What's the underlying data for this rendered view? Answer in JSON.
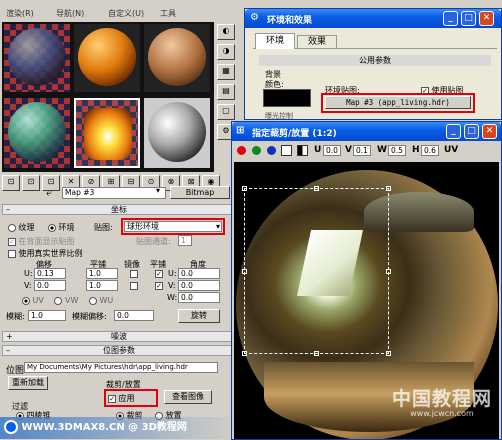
{
  "menubar": {
    "items": [
      "渲染(R)",
      "导航(N)",
      "自定义(U)",
      "工具"
    ]
  },
  "material_editor": {
    "tool_glyphs": [
      "⊡",
      "⊡",
      "⊡",
      "✕",
      "⊘",
      "⊞",
      "⊟",
      "⊙",
      "⊗",
      "⊠",
      "◉"
    ],
    "map_name": "Map #3",
    "map_type": "Bitmap",
    "coords": {
      "title": "坐标",
      "texture": "纹理",
      "environ": "环境",
      "mapping_label": "贴图:",
      "mapping_value": "球形环境",
      "show_back": "在背面显示贴图",
      "map_channel": "贴图通道:",
      "map_channel_value": "1",
      "real_world": "使用真实世界比例",
      "offset": "偏移",
      "tiling": "平铺",
      "mirror": "镜像",
      "tile": "平铺",
      "angle": "角度",
      "u_label": "U:",
      "v_label": "V:",
      "w_label": "W:",
      "u_offset": "0.13",
      "v_offset": "0.0",
      "u_tiling": "1.0",
      "v_tiling": "1.0",
      "u_angle": "0.0",
      "v_angle": "0.0",
      "w_angle": "0.0",
      "uv": "UV",
      "vw": "VW",
      "wu": "WU",
      "blur_label": "模糊:",
      "blur_value": "1.0",
      "blur_offset_label": "模糊偏移:",
      "blur_offset_value": "0.0",
      "rotate": "旋转"
    },
    "noise_title": "噪波",
    "bitmap_params": {
      "title": "位图参数",
      "bitmap_label": "位图:",
      "bitmap_path": "My Documents\\My Pictures\\hdr\\app_living.hdr",
      "reload": "重新加载",
      "crop_title": "裁剪/放置",
      "apply": "应用",
      "view_image": "查看图像",
      "crop": "裁剪",
      "place": "放置",
      "filter_title": "过滤",
      "four_direction": "四棱锥"
    }
  },
  "env_dialog": {
    "title": "环境和效果",
    "tabs": [
      "环境",
      "效果"
    ],
    "common_params": "公用参数",
    "background": "背景",
    "color": "颜色:",
    "env_map": "环境贴图:",
    "use_map": "使用贴图",
    "map_button": "Map #3 (app_living.hdr)",
    "exposure": "曝光控制",
    "bg_color": "#000000"
  },
  "crop_dialog": {
    "title": "指定裁剪/放置 (1:2)",
    "u_label": "U",
    "u_value": "0.0",
    "v_label": "V",
    "v_value": "0.1",
    "w_label": "W",
    "w_value": "0.5",
    "h_label": "H",
    "h_value": "0.6",
    "uv_label": "UV"
  },
  "watermark": {
    "logo_text": "中国教程网",
    "url_text": "www.jcwcn.com",
    "site": "WWW.3DMAX8.CN",
    "at": "@",
    "name": "3D教程网"
  },
  "colors": {
    "accent_red": "#e00010",
    "xp_blue": "#0a5ee6",
    "panel": "#d4d0c8"
  }
}
